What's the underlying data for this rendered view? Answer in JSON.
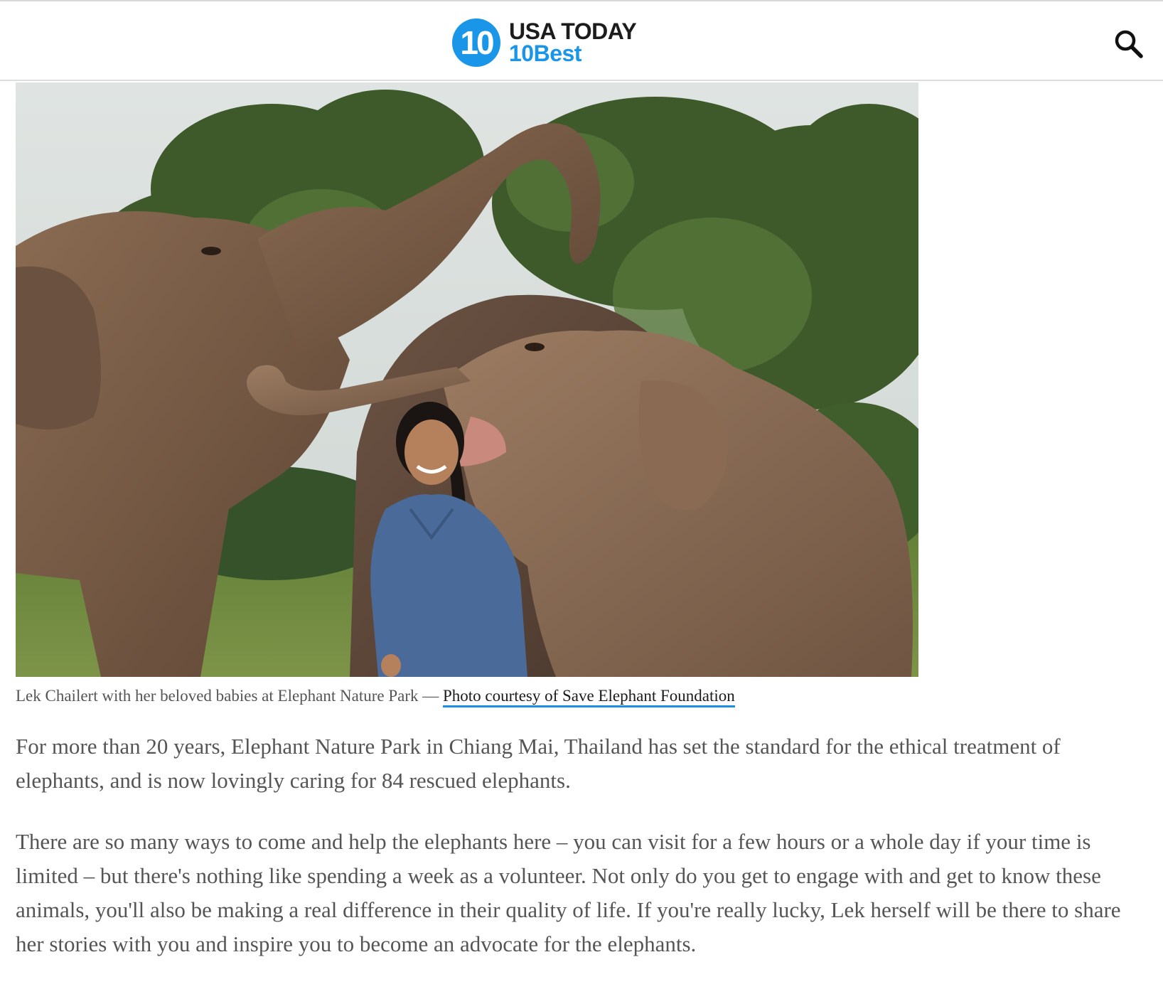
{
  "header": {
    "logo_badge": "10",
    "logo_line1": "USA TODAY",
    "logo_line2": "10Best",
    "search_icon": "search-icon"
  },
  "colors": {
    "brand_blue": "#1a96e8",
    "body_text": "#555555",
    "link_underline": "#1a8fe3"
  },
  "hero_image": {
    "alt": "Lek Chailert with her beloved babies at Elephant Nature Park"
  },
  "caption": {
    "text": "Lek Chailert with her beloved babies at Elephant Nature Park — ",
    "credit_link": "Photo courtesy of Save Elephant Foundation"
  },
  "article": {
    "paragraphs": [
      "For more than 20 years, Elephant Nature Park in Chiang Mai, Thailand has set the standard for the ethical treatment of elephants, and is now lovingly caring for 84 rescued elephants.",
      "There are so many ways to come and help the elephants here – you can visit for a few hours or a whole day if your time is limited – but there's nothing like spending a week as a volunteer. Not only do you get to engage with and get to know these animals, you'll also be making a real difference in their quality of life. If you're really lucky, Lek herself will be there to share her stories with you and inspire you to become an advocate for the elephants."
    ]
  }
}
